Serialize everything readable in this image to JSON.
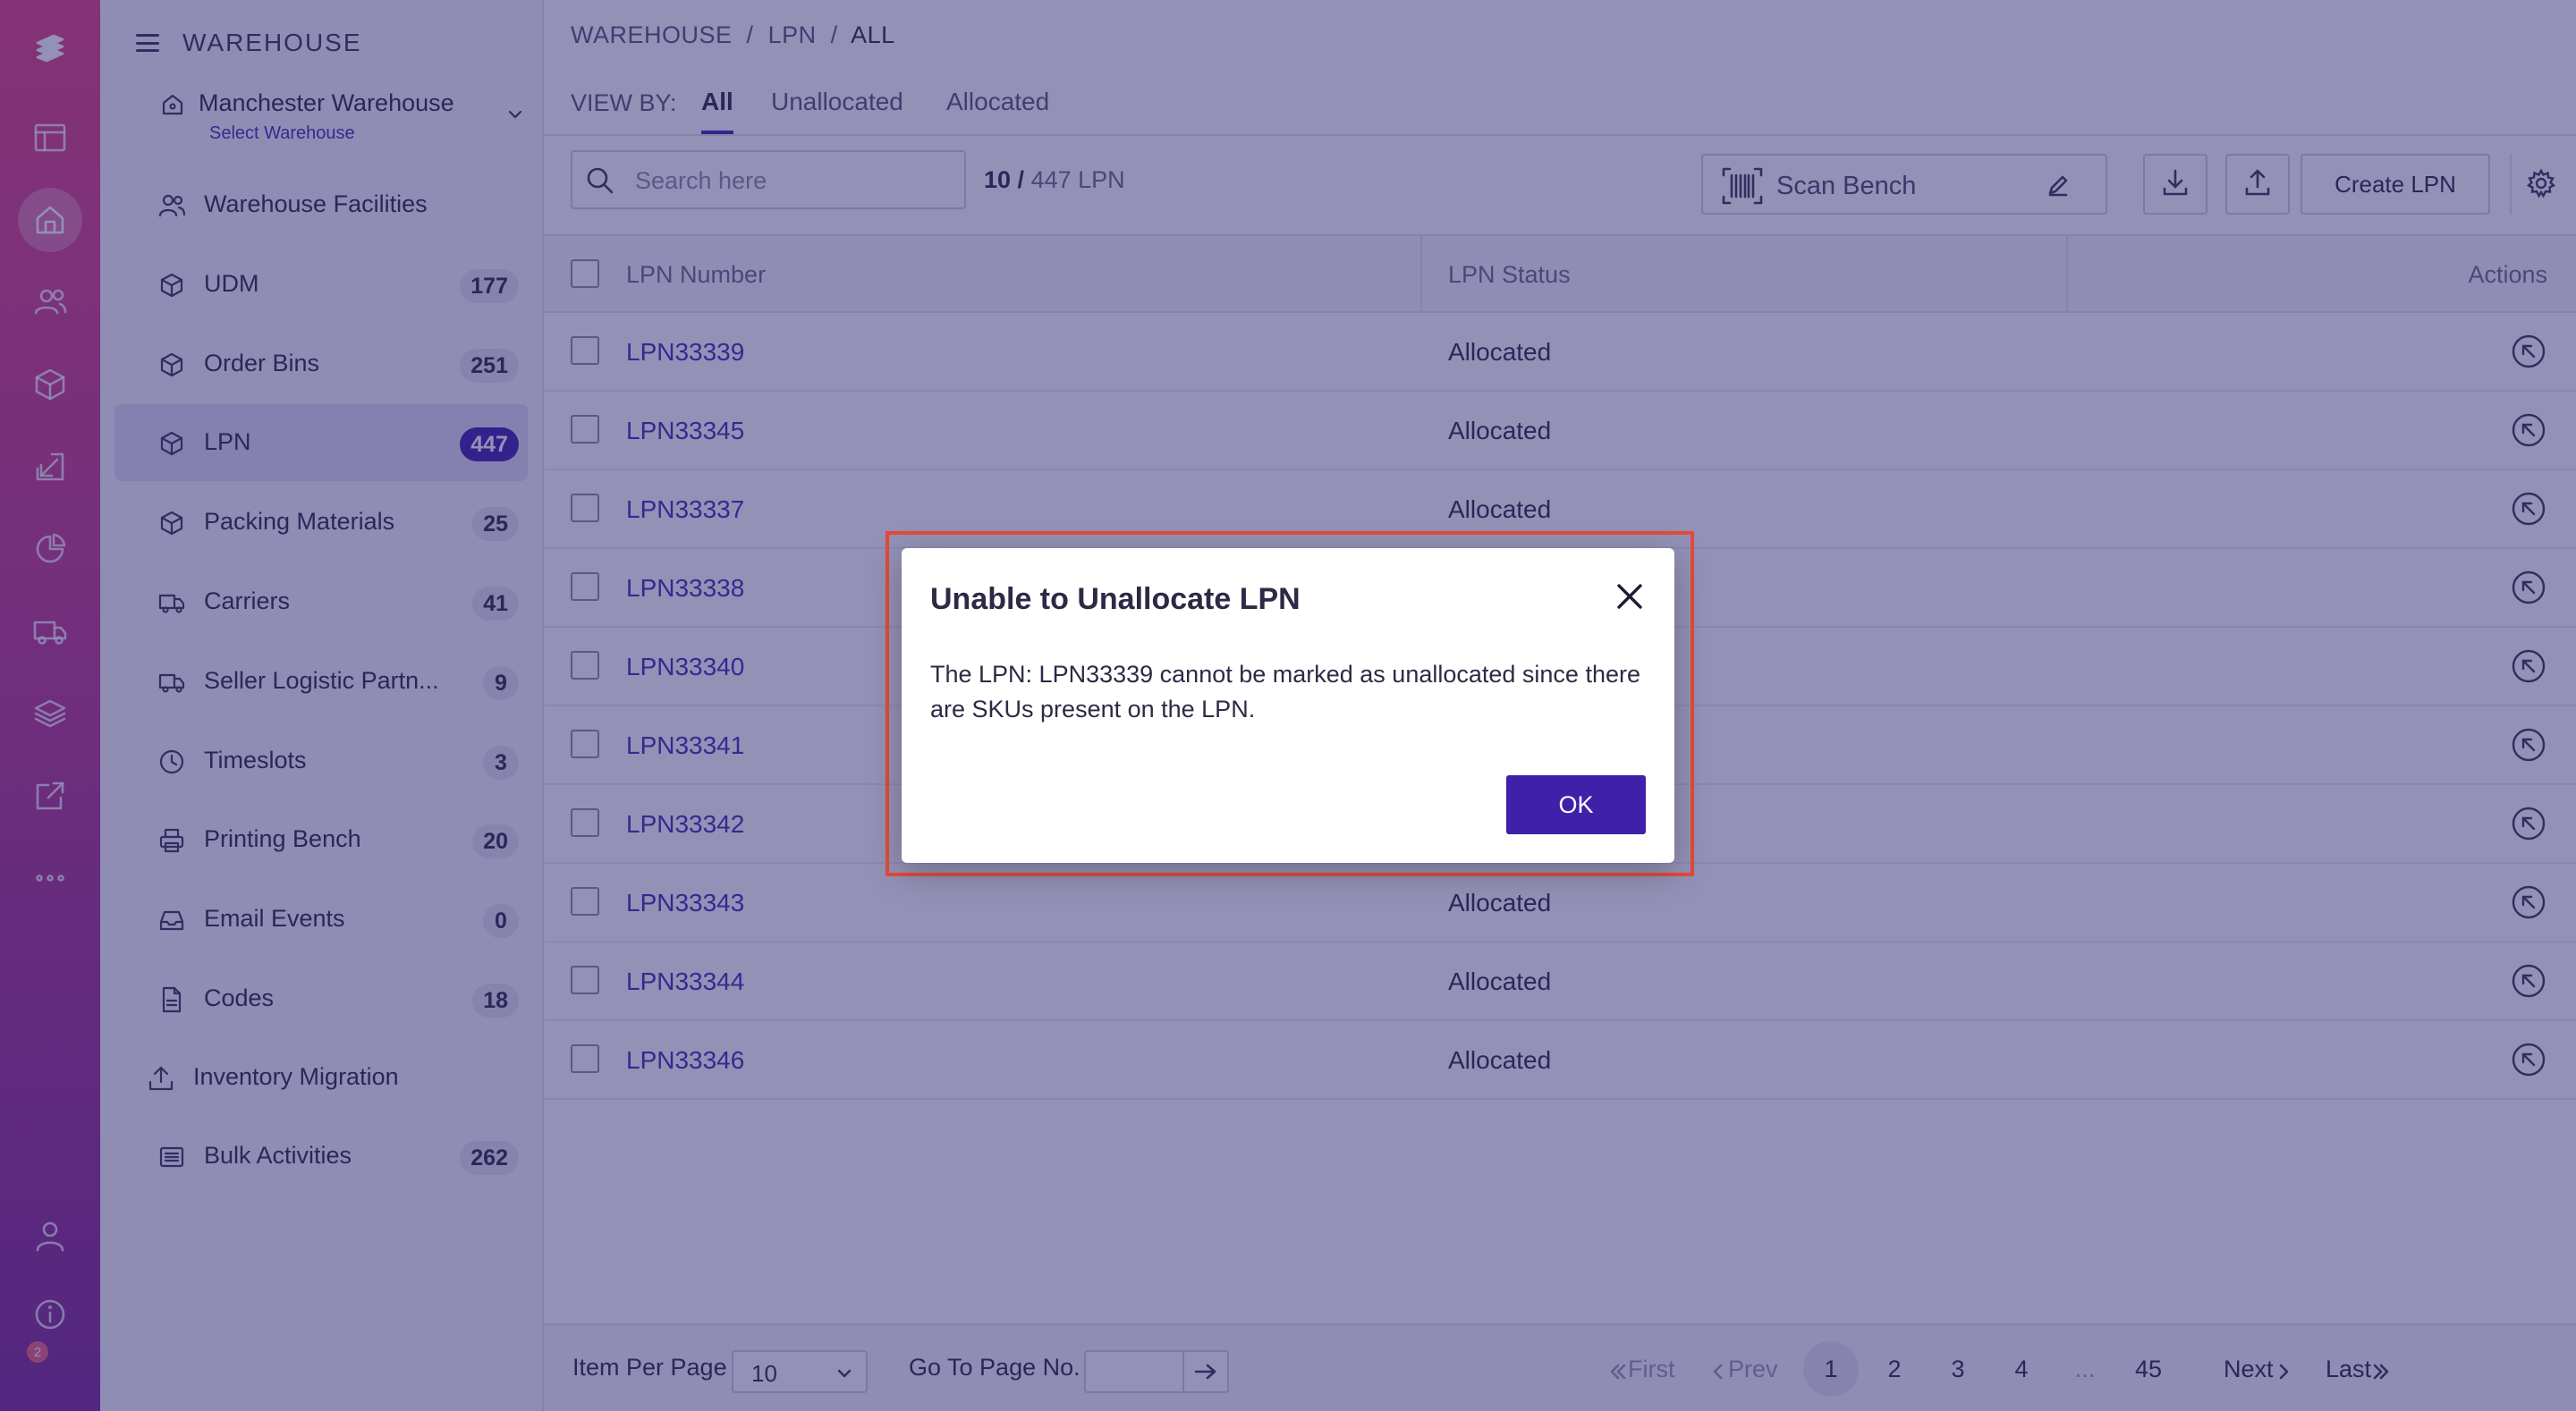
{
  "sidebar": {
    "section_title": "WAREHOUSE",
    "warehouse": {
      "name": "Manchester Warehouse",
      "sub_label": "Select Warehouse"
    },
    "items": [
      {
        "label": "Warehouse Facilities",
        "icon": "users-icon",
        "count": ""
      },
      {
        "label": "UDM",
        "icon": "box-icon",
        "count": "177"
      },
      {
        "label": "Order Bins",
        "icon": "box-icon",
        "count": "251"
      },
      {
        "label": "LPN",
        "icon": "box-icon",
        "count": "447",
        "active": true
      },
      {
        "label": "Packing Materials",
        "icon": "box-icon",
        "count": "25"
      },
      {
        "label": "Carriers",
        "icon": "truck-icon",
        "count": "41"
      },
      {
        "label": "Seller Logistic Partn...",
        "icon": "truck-icon",
        "count": "9"
      },
      {
        "label": "Timeslots",
        "icon": "clock-icon",
        "count": "3"
      },
      {
        "label": "Printing Bench",
        "icon": "printer-icon",
        "count": "20"
      },
      {
        "label": "Email Events",
        "icon": "inbox-icon",
        "count": "0"
      },
      {
        "label": "Codes",
        "icon": "file-icon",
        "count": "18"
      },
      {
        "label": "Inventory Migration",
        "icon": "upload-icon",
        "count": ""
      },
      {
        "label": "Bulk Activities",
        "icon": "list-icon",
        "count": "262"
      }
    ]
  },
  "rail": {
    "badge": "2"
  },
  "breadcrumb": {
    "part1": "WAREHOUSE",
    "sep": "/",
    "part2": "LPN",
    "part3": "ALL"
  },
  "view_by": {
    "label": "VIEW BY:",
    "tabs": [
      {
        "label": "All",
        "active": true
      },
      {
        "label": "Unallocated"
      },
      {
        "label": "Allocated"
      }
    ]
  },
  "toolbar": {
    "search_placeholder": "Search here",
    "count_shown": "10",
    "count_sep": " / ",
    "count_total": "447 LPN",
    "scan_bench_label": "Scan Bench",
    "create_label": "Create LPN"
  },
  "table": {
    "columns": [
      "LPN Number",
      "LPN Status",
      "Actions"
    ],
    "rows": [
      {
        "lpn": "LPN33339",
        "status": "Allocated"
      },
      {
        "lpn": "LPN33345",
        "status": "Allocated"
      },
      {
        "lpn": "LPN33337",
        "status": "Allocated"
      },
      {
        "lpn": "LPN33338",
        "status": ""
      },
      {
        "lpn": "LPN33340",
        "status": ""
      },
      {
        "lpn": "LPN33341",
        "status": ""
      },
      {
        "lpn": "LPN33342",
        "status": ""
      },
      {
        "lpn": "LPN33343",
        "status": "Allocated"
      },
      {
        "lpn": "LPN33344",
        "status": "Allocated"
      },
      {
        "lpn": "LPN33346",
        "status": "Allocated"
      }
    ]
  },
  "footer": {
    "items_per_page_label": "Item Per Page",
    "items_per_page_value": "10",
    "goto_label": "Go To Page No.",
    "first": "First",
    "prev": "Prev",
    "pages": [
      "1",
      "2",
      "3",
      "4",
      "...",
      "45"
    ],
    "current_page": "1",
    "next": "Next",
    "last": "Last"
  },
  "modal": {
    "title": "Unable to Unallocate LPN",
    "message": "The LPN: LPN33339 cannot be marked as unallocated since there are SKUs present on the LPN.",
    "ok_label": "OK"
  },
  "colors": {
    "accent": "#3e21a8",
    "highlight_border": "#e24b3a",
    "rail_top": "#e0437e",
    "rail_bottom": "#7d2a90"
  }
}
